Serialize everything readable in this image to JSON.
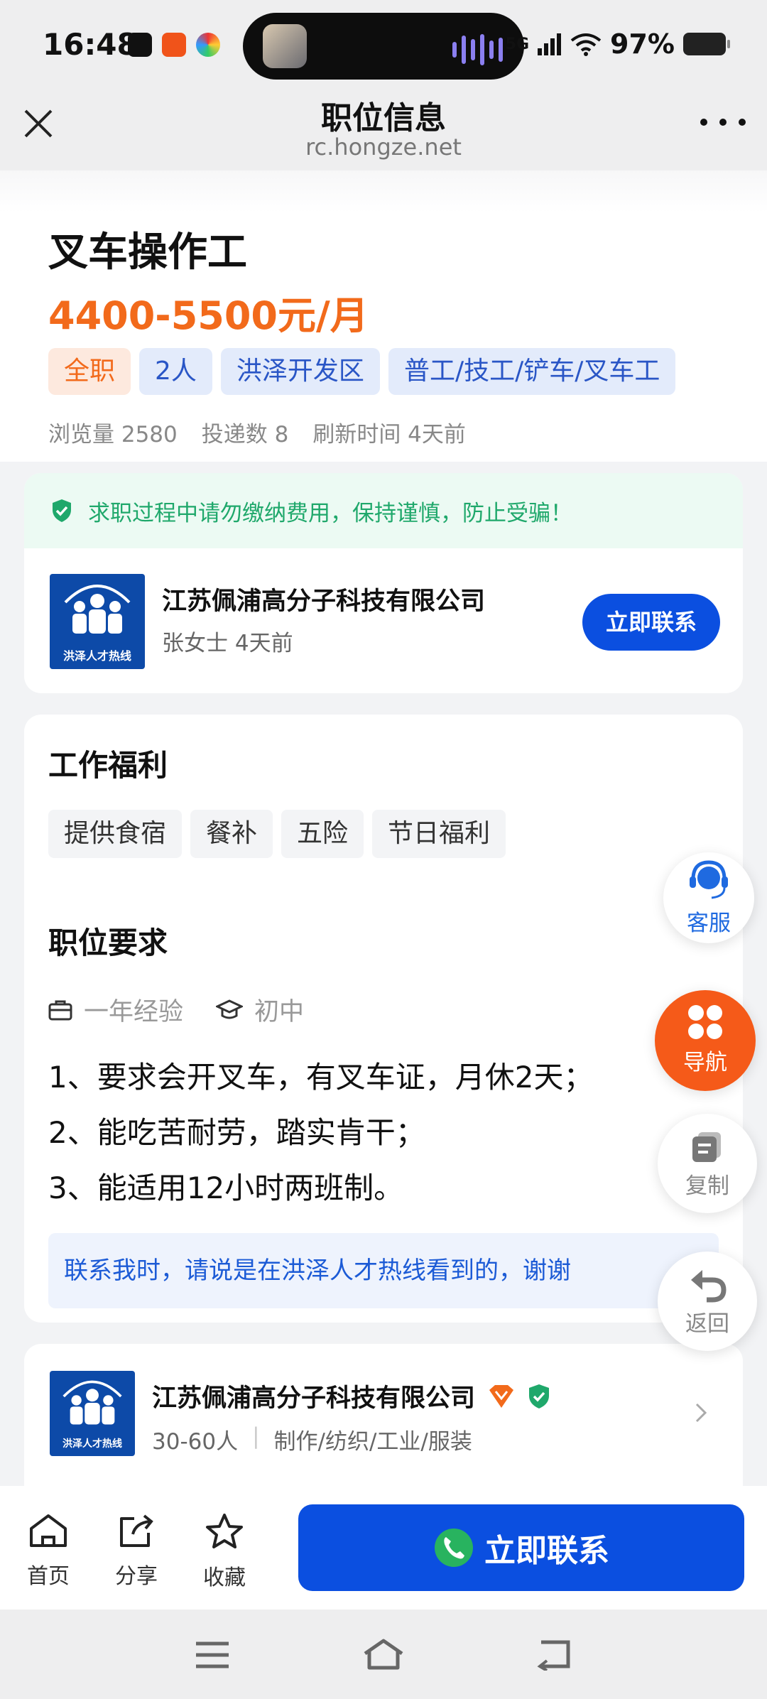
{
  "status_bar": {
    "time": "16:48",
    "network": "5G",
    "battery": "97%"
  },
  "header": {
    "title": "职位信息",
    "url": "rc.hongze.net"
  },
  "job": {
    "title": "叉车操作工",
    "salary": "4400-5500元/月",
    "tags": [
      "全职",
      "2人",
      "洪泽开发区",
      "普工/技工/铲车/叉车工"
    ],
    "views": "浏览量 2580",
    "applications": "投递数 8",
    "refreshed": "刷新时间 4天前"
  },
  "warning": "求职过程中请勿缴纳费用，保持谨慎，防止受骗！",
  "employer": {
    "logo_text": "洪泽人才热线",
    "company": "江苏佩浦高分子科技有限公司",
    "contact": "张女士  4天前",
    "contact_button": "立即联系"
  },
  "benefits": {
    "title": "工作福利",
    "items": [
      "提供食宿",
      "餐补",
      "五险",
      "节日福利"
    ]
  },
  "requirements": {
    "title": "职位要求",
    "experience": "一年经验",
    "education": "初中",
    "lines": [
      "1、要求会开叉车，有叉车证，月休2天；",
      "2、能吃苦耐劳，踏实肯干；",
      "3、能适用12小时两班制。"
    ],
    "notice": "联系我时，请说是在洪泽人才热线看到的，谢谢"
  },
  "company_card": {
    "name": "江苏佩浦高分子科技有限公司",
    "size": "30-60人",
    "industry": "制作/纺织/工业/服装"
  },
  "floating": {
    "service": "客服",
    "nav": "导航",
    "copy": "复制",
    "back": "返回"
  },
  "bottom": {
    "home": "首页",
    "share": "分享",
    "favorite": "收藏",
    "contact": "立即联系"
  },
  "colors": {
    "accent_blue": "#0b4fe0",
    "salary_orange": "#f26a1b",
    "warn_green": "#1fa86b",
    "nav_orange": "#f55a19"
  }
}
